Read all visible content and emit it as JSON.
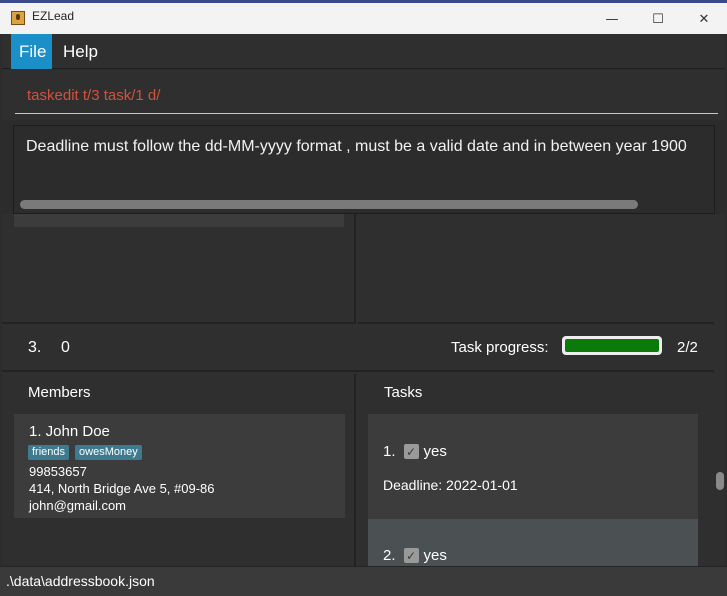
{
  "window": {
    "title": "EZLead",
    "minimize_glyph": "—",
    "maximize_glyph": "☐",
    "close_glyph": "✕"
  },
  "menu": {
    "file_label": "File",
    "help_label": "Help"
  },
  "command": {
    "value": "taskedit t/3 task/1 d/"
  },
  "result": {
    "message": "Deadline must follow the dd-MM-yyyy format , must be a valid date and in between year 1900"
  },
  "team": {
    "index": "3.",
    "name": "0",
    "progress_label": "Task progress:",
    "progress_fraction": 1.0,
    "progress_count": "2/2"
  },
  "members": {
    "header": "Members",
    "items": [
      {
        "name": "1.  John Doe",
        "tags": [
          "friends",
          "owesMoney"
        ],
        "phone": "99853657",
        "address": "414, North Bridge Ave 5, #09-86",
        "email": "john@gmail.com"
      }
    ]
  },
  "tasks": {
    "header": "Tasks",
    "items": [
      {
        "index": "1.",
        "name": "yes",
        "done": true,
        "deadline": "Deadline: 2022-01-01"
      },
      {
        "index": "2.",
        "name": "yes",
        "done": true
      }
    ]
  },
  "status": {
    "path": ".\\data\\addressbook.json"
  },
  "colors": {
    "menu_active": "#1b8fc7",
    "command_text": "#d0533d",
    "progress_fill": "#0b7a0b",
    "tag_bg": "#3e7b91"
  }
}
